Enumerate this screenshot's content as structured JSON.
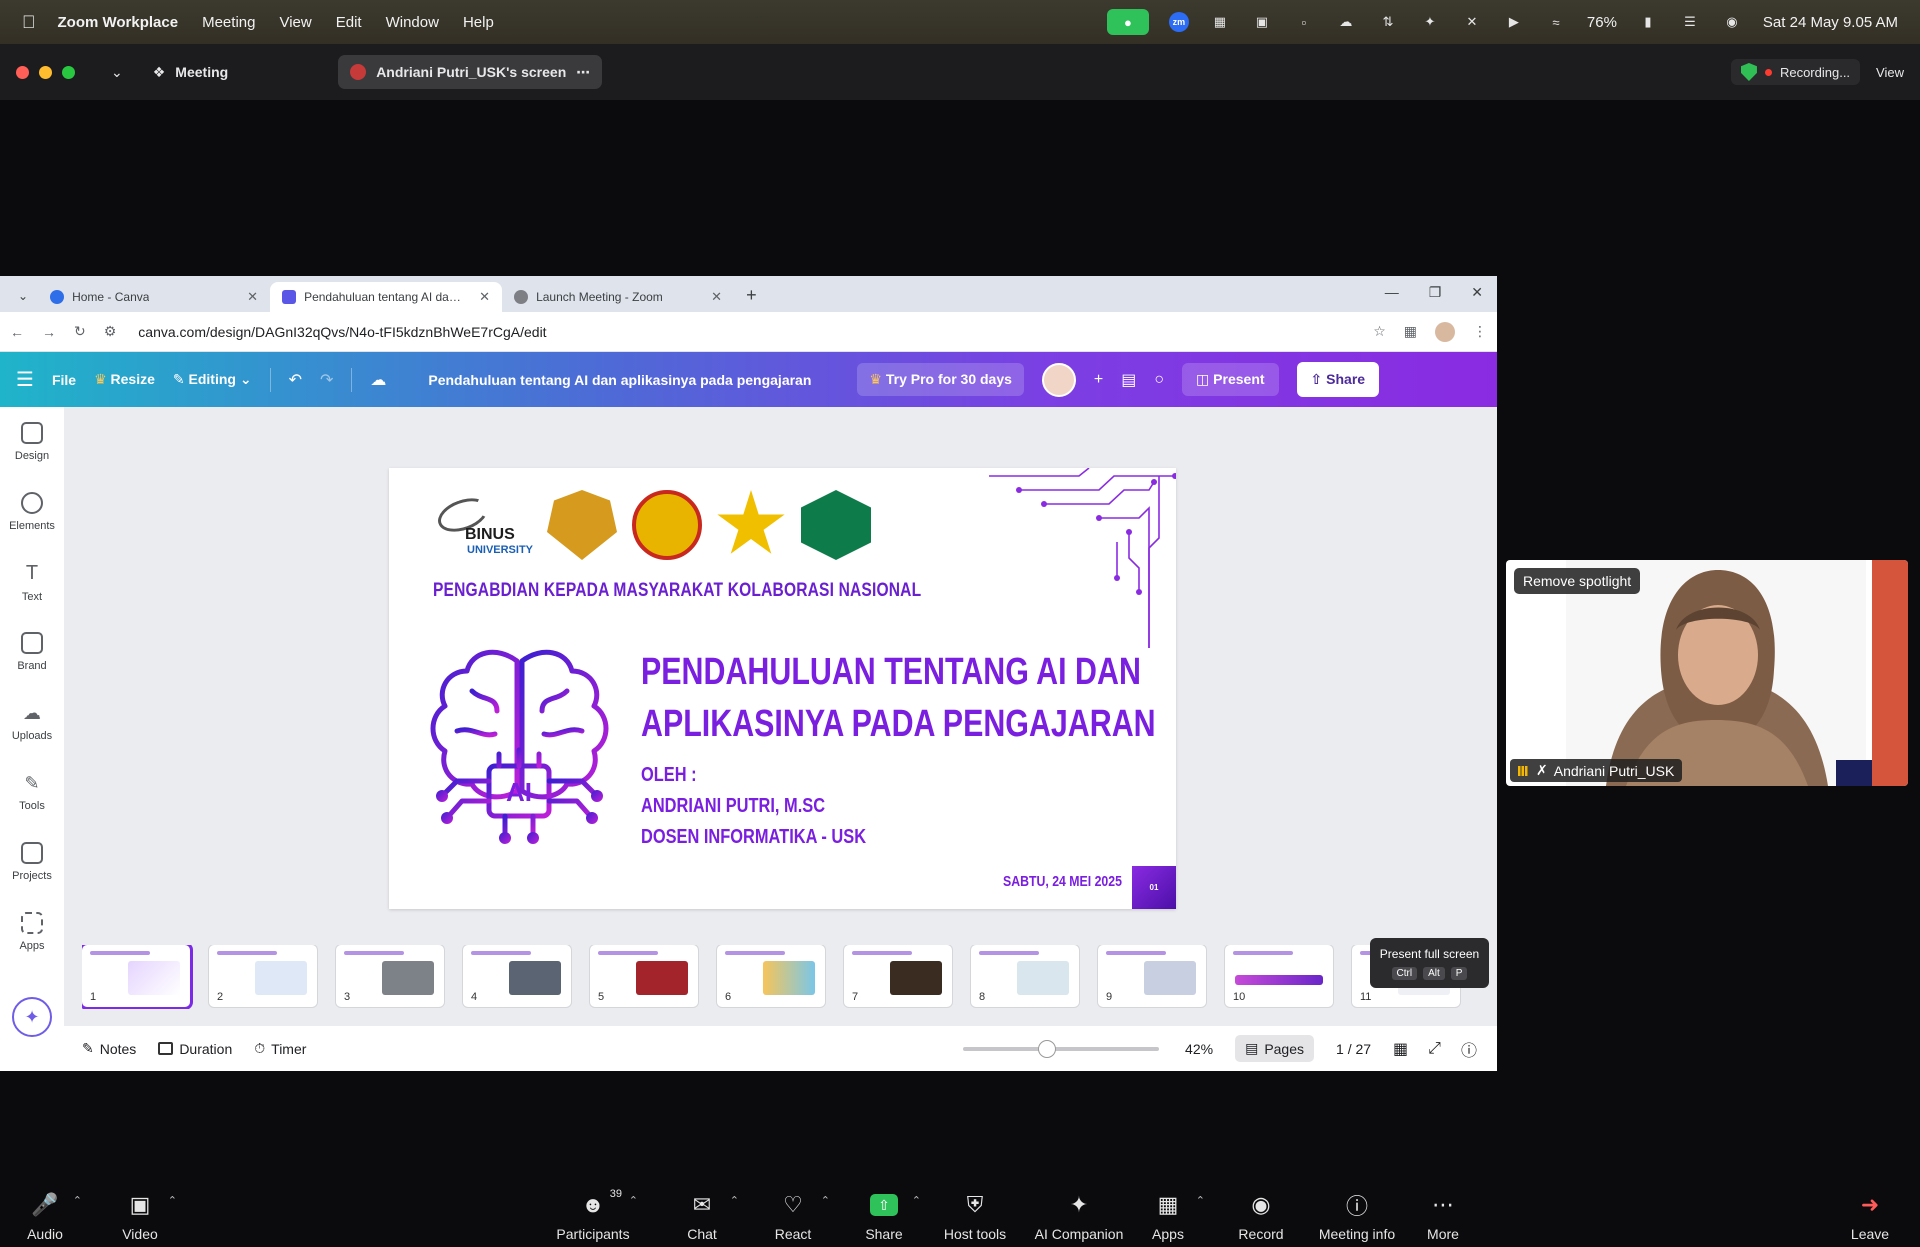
{
  "menubar": {
    "app": "Zoom Workplace",
    "menus": [
      "Meeting",
      "View",
      "Edit",
      "Window",
      "Help"
    ],
    "battery": "76%",
    "datetime": "Sat 24 May  9.05 AM"
  },
  "zoom_header": {
    "meeting_label": "Meeting",
    "screen_share_label": "Andriani Putri_USK's screen",
    "recording_label": "Recording...",
    "view_label": "View"
  },
  "browser": {
    "tabs": [
      {
        "title": "Home - Canva",
        "favicon_color": "#2f6ee9"
      },
      {
        "title": "Pendahuluan tentang AI dan ap",
        "favicon_color": "#5a57e6"
      },
      {
        "title": "Launch Meeting - Zoom",
        "favicon_color": "#7d7f85"
      }
    ],
    "url": "canva.com/design/DAGnI32qQvs/N4o-tFI5kdznBhWeE7rCgA/edit"
  },
  "canva": {
    "file_label": "File",
    "resize_label": "Resize",
    "editing_label": "Editing",
    "doc_title": "Pendahuluan tentang AI dan aplikasinya pada pengajaran",
    "try_pro_label": "Try Pro for 30 days",
    "present_label": "Present",
    "share_label": "Share",
    "rail": [
      "Design",
      "Elements",
      "Text",
      "Brand",
      "Uploads",
      "Tools",
      "Projects",
      "Apps"
    ],
    "bottom": {
      "notes": "Notes",
      "duration": "Duration",
      "timer": "Timer",
      "zoom": "42%",
      "zoom_fraction": 0.42,
      "pages_label": "Pages",
      "page_count": "1 / 27"
    },
    "tooltip": {
      "title": "Present full screen",
      "keys": [
        "Ctrl",
        "Alt",
        "P"
      ]
    },
    "thumbnails": [
      "1",
      "2",
      "3",
      "4",
      "5",
      "6",
      "7",
      "8",
      "9",
      "10",
      "11"
    ]
  },
  "slide": {
    "binus_name": "BINUS",
    "binus_sub": "UNIVERSITY",
    "subtitle": "PENGABDIAN KEPADA MASYARAKAT KOLABORASI NASIONAL",
    "title_line1": "PENDAHULUAN TENTANG AI DAN",
    "title_line2": "APLIKASINYA PADA PENGAJARAN",
    "by_label": "OLEH :",
    "presenter": "ANDRIANI PUTRI, M.SC",
    "role": "DOSEN INFORMATIKA - USK",
    "date": "SABTU, 24 MEI 2025",
    "slide_number": "01",
    "brain_label": "AI",
    "accent": "#7a1ee0"
  },
  "video_tile": {
    "spotlight_label": "Remove spotlight",
    "participant_name": "Andriani Putri_USK"
  },
  "controls": {
    "audio": "Audio",
    "video": "Video",
    "participants": "Participants",
    "participants_count": "39",
    "chat": "Chat",
    "react": "React",
    "share": "Share",
    "host_tools": "Host tools",
    "ai_companion": "AI Companion",
    "apps": "Apps",
    "record": "Record",
    "meeting_info": "Meeting info",
    "more": "More",
    "leave": "Leave"
  }
}
